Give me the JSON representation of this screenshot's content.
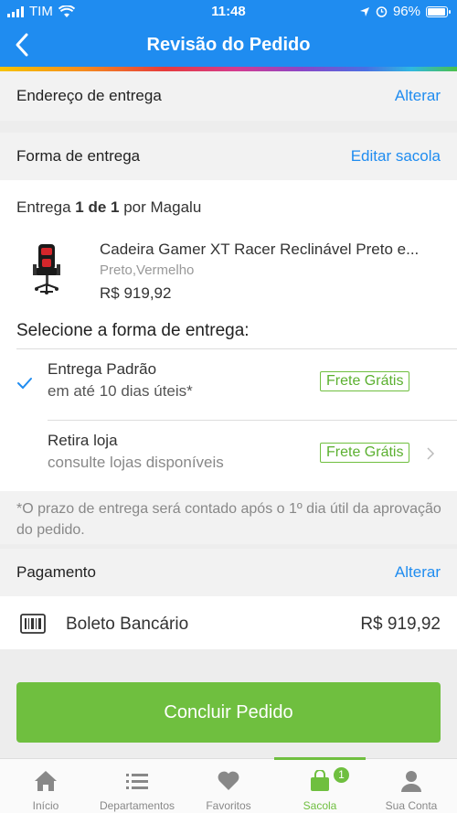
{
  "status_bar": {
    "carrier": "TIM",
    "time": "11:48",
    "battery": "96%"
  },
  "header": {
    "title": "Revisão do Pedido"
  },
  "address": {
    "label": "Endereço de entrega",
    "action": "Alterar"
  },
  "delivery_method": {
    "label": "Forma de entrega",
    "action": "Editar sacola"
  },
  "shipment": {
    "prefix": "Entrega",
    "count": "1 de 1",
    "suffix": "por Magalu",
    "product": {
      "name": "Cadeira Gamer XT Racer Reclinável Preto e...",
      "variant": "Preto,Vermelho",
      "price": "R$ 919,92"
    }
  },
  "delivery_options": {
    "heading": "Selecione a forma de entrega:",
    "options": [
      {
        "title": "Entrega Padrão",
        "detail": "em até 10 dias úteis*",
        "tag": "Frete Grátis",
        "selected": true
      },
      {
        "title": "Retira loja",
        "detail": "consulte lojas disponíveis",
        "tag": "Frete Grátis",
        "selected": false
      }
    ],
    "note": "*O prazo de entrega será contado após o 1º dia útil da aprovação do pedido."
  },
  "payment": {
    "label": "Pagamento",
    "action": "Alterar",
    "method": "Boleto Bancário",
    "amount": "R$ 919,92"
  },
  "checkout": {
    "button": "Concluir Pedido"
  },
  "bottom_nav": {
    "items": [
      {
        "label": "Início",
        "icon": "home-icon"
      },
      {
        "label": "Departamentos",
        "icon": "list-icon"
      },
      {
        "label": "Favoritos",
        "icon": "heart-icon"
      },
      {
        "label": "Sacola",
        "icon": "bag-icon",
        "badge": "1",
        "active": true
      },
      {
        "label": "Sua Conta",
        "icon": "user-icon"
      }
    ]
  },
  "colors": {
    "primary": "#1f8cf0",
    "green": "#6fbf3f"
  }
}
